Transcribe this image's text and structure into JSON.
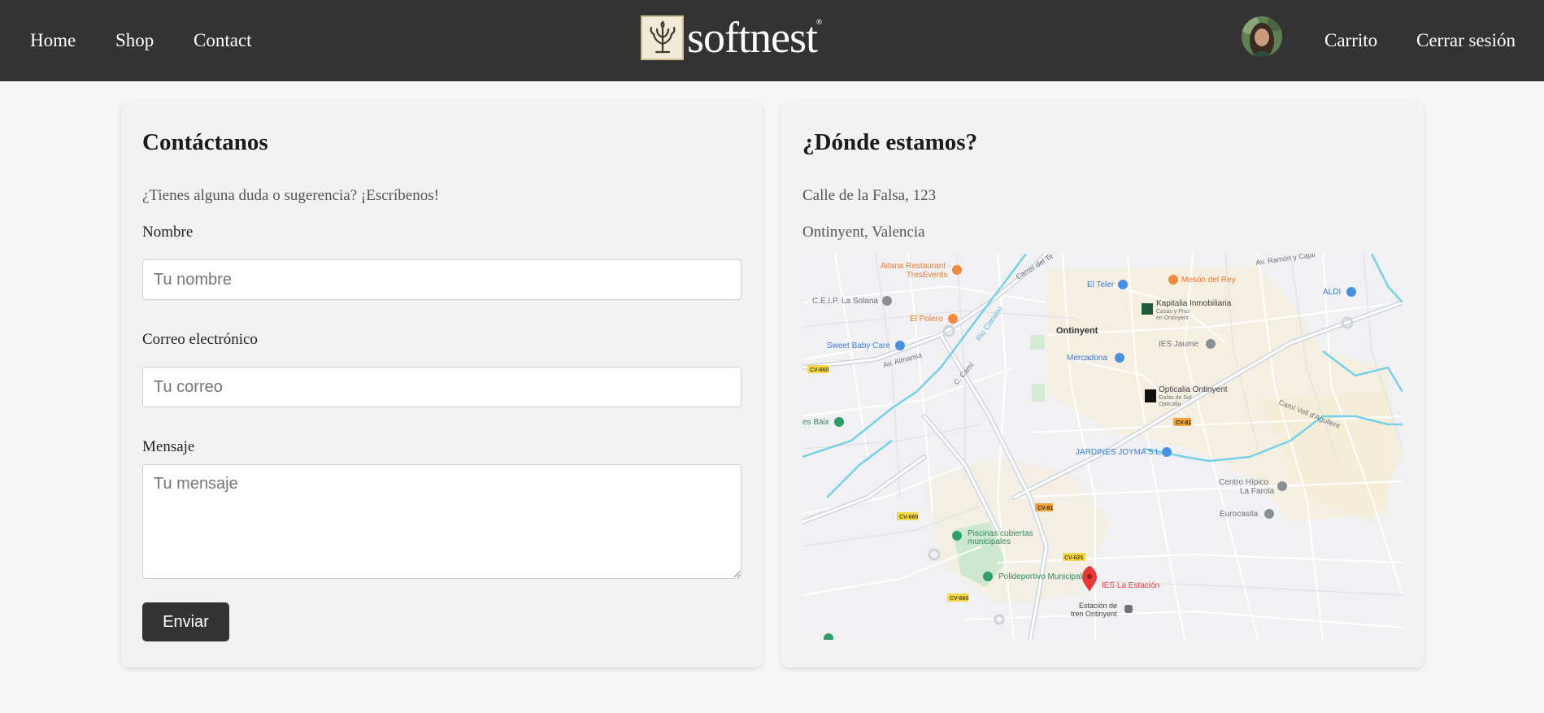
{
  "nav": {
    "home": "Home",
    "shop": "Shop",
    "contact": "Contact",
    "brand": "softnest",
    "cart": "Carrito",
    "logout": "Cerrar sesión"
  },
  "contact_form": {
    "title": "Contáctanos",
    "intro": "¿Tienes alguna duda o sugerencia? ¡Escríbenos!",
    "name_label": "Nombre",
    "name_placeholder": "Tu nombre",
    "email_label": "Correo electrónico",
    "email_placeholder": "Tu correo",
    "message_label": "Mensaje",
    "message_placeholder": "Tu mensaje",
    "submit_label": "Enviar"
  },
  "location": {
    "title": "¿Dónde estamos?",
    "address_line1": "Calle de la Falsa, 123",
    "address_line2": "Ontinyent, Valencia",
    "map_labels": {
      "aitana": "Aitana Restaurant -",
      "tresevents": "TresEvents",
      "meson": "Mesón del Rey",
      "el_teler": "El Teler",
      "carrer": "Carrer del Te",
      "ceip": "C.E.I.P. La Solana",
      "kapitalia": "Kapitalia Inmobiliaria",
      "kapitalia_sub1": "Casas y Piso",
      "kapitalia_sub2": "en Ontinyent",
      "aldi": "ALDI",
      "av_ramon": "Av. Ramón y Cajal",
      "el_polero": "El Polero",
      "ontinyent": "Ontinyent",
      "sweet_baby": "Sweet Baby Care",
      "ies_jaume": "IES Jaume",
      "mercadona": "Mercadona",
      "av_almansa": "Av. Almansa",
      "opticalia": "Opticalia Ontinyent",
      "opticalia_sub1": "Gafas de Sol",
      "opticalia_sub2": "Opticalia",
      "es_baix": "es Baix",
      "cami_vell": "Camí Vell d'Agullent",
      "jardines": "JARDINES JOYMA S.L.",
      "centro_hipico": "Centro Hípico",
      "la_farola": "La Farola",
      "eurocasita": "Eurocasita",
      "piscinas1": "Piscinas cubiertas",
      "piscinas2": "municipales",
      "polideportivo": "Polideportivo Municipal",
      "ies_estacion": "IES La Estación",
      "estacion1": "Estación de",
      "estacion2": "tren Ontinyent",
      "cv660": "CV-660",
      "cv81": "CV-81",
      "cv625": "CV-625",
      "c_camí": "C. Camí",
      "carrer_rio": "Riu Clariano"
    }
  },
  "colors": {
    "navbar": "#333333",
    "button": "#333333",
    "card": "#f2f2f2",
    "background": "#f6f6f6",
    "map_pin": "#e53935"
  }
}
